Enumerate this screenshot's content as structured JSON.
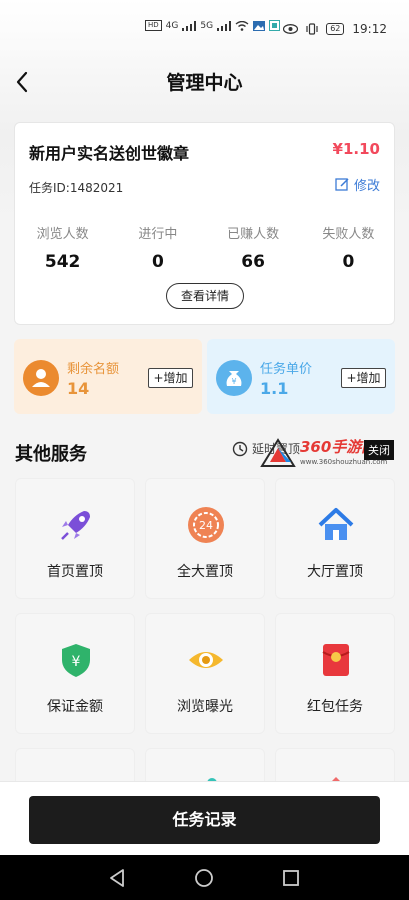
{
  "status_bar": {
    "time": "19:12",
    "battery": "62",
    "network": [
      "HD",
      "4G",
      "5G"
    ]
  },
  "header": {
    "title": "管理中心"
  },
  "task_card": {
    "title": "新用户实名送创世徽章",
    "price": "¥1.10",
    "task_id_label": "任务ID:1482021",
    "edit_label": "修改",
    "stats": [
      {
        "label": "浏览人数",
        "value": "542"
      },
      {
        "label": "进行中",
        "value": "0"
      },
      {
        "label": "已赚人数",
        "value": "66"
      },
      {
        "label": "失败人数",
        "value": "0"
      }
    ],
    "detail_button": "查看详情"
  },
  "quota": {
    "remaining_label": "剩余名额",
    "remaining_value": "14",
    "unit_price_label": "任务单价",
    "unit_price_value": "1.1",
    "add_label": "+增加",
    "remaining_color": "#e8943a",
    "unit_price_color": "#4aa8e8"
  },
  "other_services": {
    "title": "其他服务",
    "aside_text": "延时置顶",
    "tiles": [
      {
        "label": "首页置顶",
        "icon": "rocket-icon"
      },
      {
        "label": "全大置顶",
        "icon": "timer-24-icon"
      },
      {
        "label": "大厅置顶",
        "icon": "house-icon"
      },
      {
        "label": "保证金额",
        "icon": "shield-yuan-icon"
      },
      {
        "label": "浏览曝光",
        "icon": "eye-icon"
      },
      {
        "label": "红包任务",
        "icon": "red-packet-icon"
      }
    ]
  },
  "ad_overlay": {
    "brand": "360手游网",
    "url": "www.360shouzhuan.com",
    "close_label": "关闭"
  },
  "bottom": {
    "record_button": "任务记录"
  }
}
